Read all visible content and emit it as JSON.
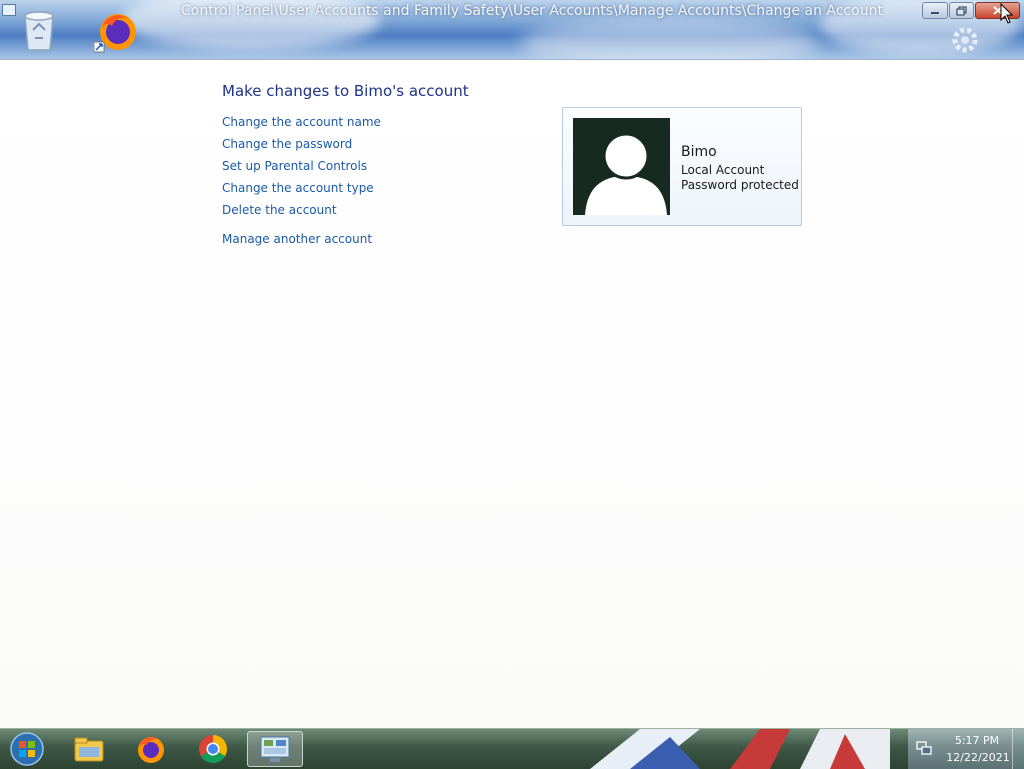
{
  "window": {
    "title": "Control Panel\\User Accounts and Family Safety\\User Accounts\\Manage Accounts\\Change an Account"
  },
  "page": {
    "heading": "Make changes to Bimo's account",
    "links": [
      "Change the account name",
      "Change the password",
      "Set up Parental Controls",
      "Change the account type",
      "Delete the account",
      "Manage another account"
    ]
  },
  "account": {
    "name": "Bimo",
    "type": "Local Account",
    "status": "Password protected"
  },
  "desktop_icons": [
    "recycle-bin-icon",
    "firefox-icon"
  ],
  "taskbar": {
    "items": [
      "start-orb-icon",
      "windows-explorer-icon",
      "firefox-icon",
      "chrome-icon",
      "control-panel-icon"
    ],
    "clock_time": "5:17 PM",
    "clock_date": "12/22/2021"
  },
  "colors": {
    "link": "#1b5aa8",
    "heading": "#1e3287",
    "taskbar": "#3e5746",
    "close_button": "#c8442a"
  }
}
